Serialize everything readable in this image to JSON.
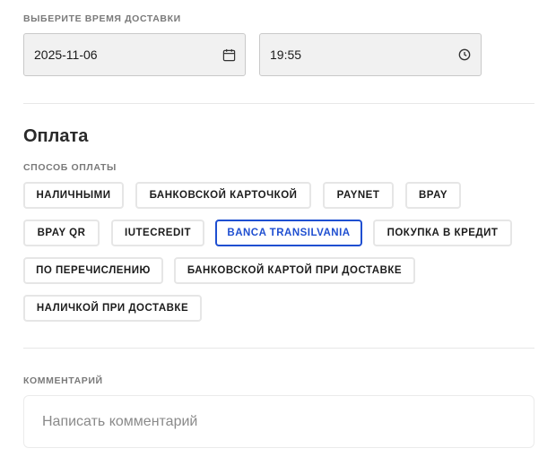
{
  "delivery": {
    "label": "Выберите время доставки",
    "date_value": "2025-11-06",
    "time_value": "19:55",
    "date_icon": "calendar-icon",
    "time_icon": "clock-icon"
  },
  "payment": {
    "heading": "Оплата",
    "method_label": "Способ оплаты",
    "selected_color": "#1f4fd1",
    "methods": [
      {
        "label": "Наличными",
        "selected": false
      },
      {
        "label": "Банковской карточкой",
        "selected": false
      },
      {
        "label": "PAYNET",
        "selected": false
      },
      {
        "label": "BPAY",
        "selected": false
      },
      {
        "label": "BPAY QR",
        "selected": false
      },
      {
        "label": "IUTECREDIT",
        "selected": false
      },
      {
        "label": "Banca Transilvania",
        "selected": true
      },
      {
        "label": "Покупка в кредит",
        "selected": false
      },
      {
        "label": "По перечислению",
        "selected": false
      },
      {
        "label": "Банковской картой при доставке",
        "selected": false
      },
      {
        "label": "Наличкой при доставке",
        "selected": false
      }
    ]
  },
  "comment": {
    "label": "Комментарий",
    "placeholder": "Написать комментарий",
    "value": ""
  }
}
